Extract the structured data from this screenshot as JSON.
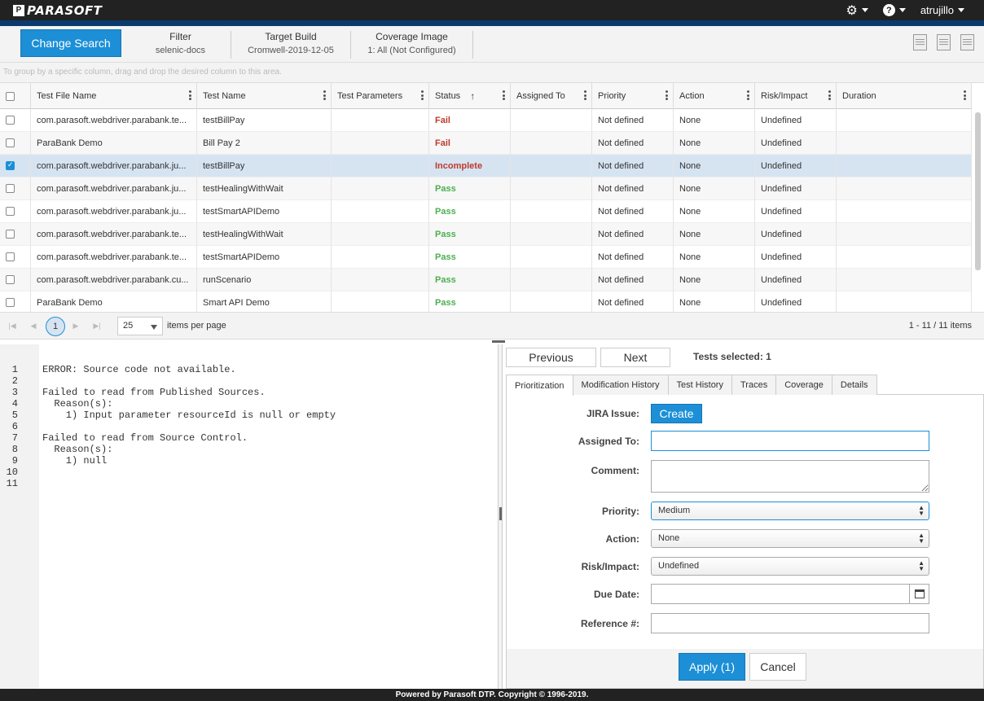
{
  "header": {
    "logo_text": "PARASOFT",
    "logo_mark": "P",
    "user": "atrujillo",
    "settings_icon": "gear-icon",
    "help_icon": "question-circle-icon",
    "help_glyph": "?"
  },
  "search": {
    "change_search_label": "Change Search",
    "criteria": [
      {
        "label": "Filter",
        "value": "selenic-docs"
      },
      {
        "label": "Target Build",
        "value": "Cromwell-2019-12-05"
      },
      {
        "label": "Coverage Image",
        "value": "1: All (Not Configured)"
      }
    ]
  },
  "grid": {
    "group_hint": "To group by a specific column, drag and drop the desired column to this area.",
    "columns": [
      "Test File Name",
      "Test Name",
      "Test Parameters",
      "Status",
      "Assigned To",
      "Priority",
      "Action",
      "Risk/Impact",
      "Duration"
    ],
    "sort_indicator": "↑",
    "rows": [
      {
        "file": "com.parasoft.webdriver.parabank.te...",
        "name": "testBillPay",
        "params": "",
        "status": "Fail",
        "assigned": "",
        "priority": "Not defined",
        "action": "None",
        "risk": "Undefined",
        "duration": ""
      },
      {
        "file": "ParaBank Demo",
        "name": "Bill Pay 2",
        "params": "",
        "status": "Fail",
        "assigned": "",
        "priority": "Not defined",
        "action": "None",
        "risk": "Undefined",
        "duration": ""
      },
      {
        "file": "com.parasoft.webdriver.parabank.ju...",
        "name": "testBillPay",
        "params": "",
        "status": "Incomplete",
        "assigned": "",
        "priority": "Not defined",
        "action": "None",
        "risk": "Undefined",
        "duration": ""
      },
      {
        "file": "com.parasoft.webdriver.parabank.ju...",
        "name": "testHealingWithWait",
        "params": "",
        "status": "Pass",
        "assigned": "",
        "priority": "Not defined",
        "action": "None",
        "risk": "Undefined",
        "duration": ""
      },
      {
        "file": "com.parasoft.webdriver.parabank.ju...",
        "name": "testSmartAPIDemo",
        "params": "",
        "status": "Pass",
        "assigned": "",
        "priority": "Not defined",
        "action": "None",
        "risk": "Undefined",
        "duration": ""
      },
      {
        "file": "com.parasoft.webdriver.parabank.te...",
        "name": "testHealingWithWait",
        "params": "",
        "status": "Pass",
        "assigned": "",
        "priority": "Not defined",
        "action": "None",
        "risk": "Undefined",
        "duration": ""
      },
      {
        "file": "com.parasoft.webdriver.parabank.te...",
        "name": "testSmartAPIDemo",
        "params": "",
        "status": "Pass",
        "assigned": "",
        "priority": "Not defined",
        "action": "None",
        "risk": "Undefined",
        "duration": ""
      },
      {
        "file": "com.parasoft.webdriver.parabank.cu...",
        "name": "runScenario",
        "params": "",
        "status": "Pass",
        "assigned": "",
        "priority": "Not defined",
        "action": "None",
        "risk": "Undefined",
        "duration": ""
      },
      {
        "file": "ParaBank Demo",
        "name": "Smart API Demo",
        "params": "",
        "status": "Pass",
        "assigned": "",
        "priority": "Not defined",
        "action": "None",
        "risk": "Undefined",
        "duration": ""
      }
    ],
    "selected_row": 2
  },
  "pager": {
    "current_page": "1",
    "page_size": "25",
    "items_per_page_label": "items per page",
    "info": "1 - 11 / 11 items",
    "first_glyph": "|◀",
    "prev_glyph": "◀",
    "next_glyph": "▶",
    "last_glyph": "▶|"
  },
  "source": {
    "line_numbers": [
      "1",
      "2",
      "3",
      "4",
      "5",
      "6",
      "7",
      "8",
      "9",
      "10",
      "11"
    ],
    "lines": [
      "ERROR: Source code not available.",
      "",
      "Failed to read from Published Sources.",
      "  Reason(s):",
      "    1) Input parameter resourceId is null or empty",
      "",
      "Failed to read from Source Control.",
      "  Reason(s):",
      "    1) null",
      "",
      ""
    ]
  },
  "detail": {
    "previous_label": "Previous",
    "next_label": "Next",
    "tests_selected": "Tests selected: 1",
    "tabs": [
      "Prioritization",
      "Modification History",
      "Test History",
      "Traces",
      "Coverage",
      "Details"
    ],
    "active_tab": "Prioritization",
    "form": {
      "jira_label": "JIRA Issue:",
      "create_label": "Create",
      "assigned_label": "Assigned To:",
      "assigned_value": "",
      "comment_label": "Comment:",
      "comment_value": "",
      "priority_label": "Priority:",
      "priority_value": "Medium",
      "action_label": "Action:",
      "action_value": "None",
      "risk_label": "Risk/Impact:",
      "risk_value": "Undefined",
      "due_label": "Due Date:",
      "due_value": "",
      "reference_label": "Reference #:",
      "reference_value": ""
    },
    "apply_label": "Apply (1)",
    "cancel_label": "Cancel"
  },
  "footer": {
    "text": "Powered by Parasoft DTP. Copyright © 1996-2019."
  },
  "colors": {
    "accent": "#1c8fd6",
    "fail": "#c0392b",
    "pass": "#4caf50",
    "header_bg": "#222222",
    "stripe": "#0b3a6e"
  }
}
